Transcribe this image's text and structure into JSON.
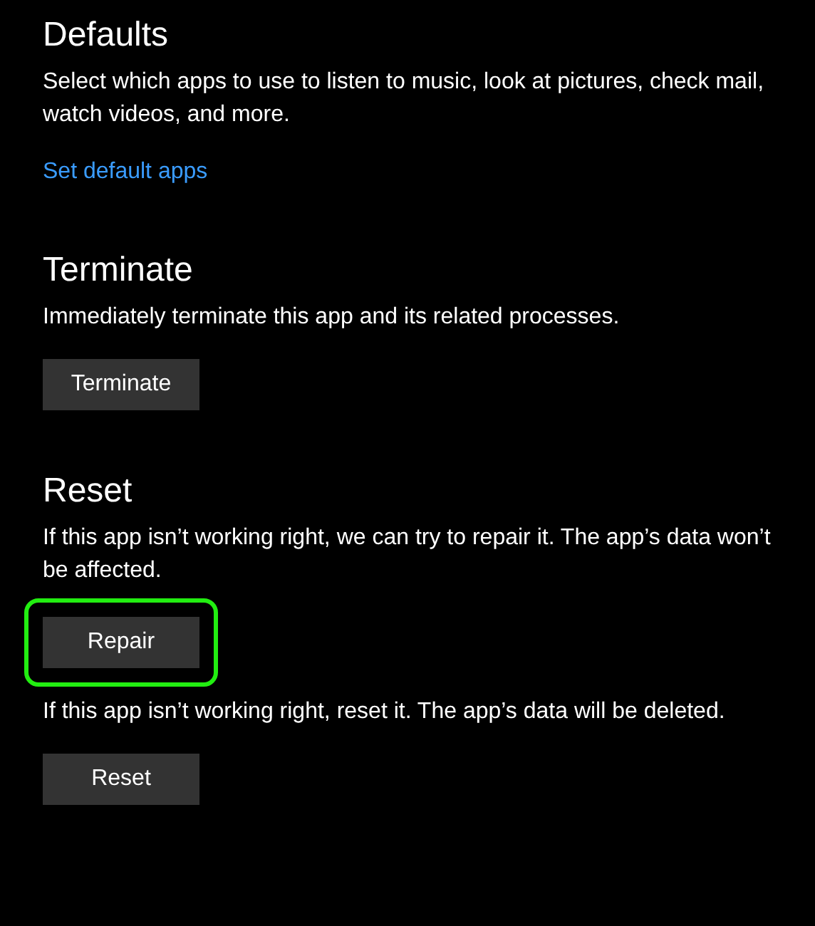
{
  "sections": [
    {
      "title": "Defaults",
      "items": [
        {
          "kind": "text",
          "text": "Select which apps to use to listen to music, look at pictures, check mail, watch videos, and more."
        },
        {
          "kind": "link",
          "text": "Set default apps"
        }
      ]
    },
    {
      "title": "Terminate",
      "items": [
        {
          "kind": "text",
          "text": "Immediately terminate this app and its related processes."
        },
        {
          "kind": "button",
          "text": "Terminate",
          "highlighted": false
        }
      ]
    },
    {
      "title": "Reset",
      "items": [
        {
          "kind": "text",
          "text": "If this app isn’t working right, we can try to repair it. The app’s data won’t be affected."
        },
        {
          "kind": "button",
          "text": "Repair",
          "highlighted": true
        },
        {
          "kind": "text",
          "text": "If this app isn’t working right, reset it. The app’s data will be deleted."
        },
        {
          "kind": "button",
          "text": "Reset",
          "highlighted": false
        }
      ]
    }
  ]
}
